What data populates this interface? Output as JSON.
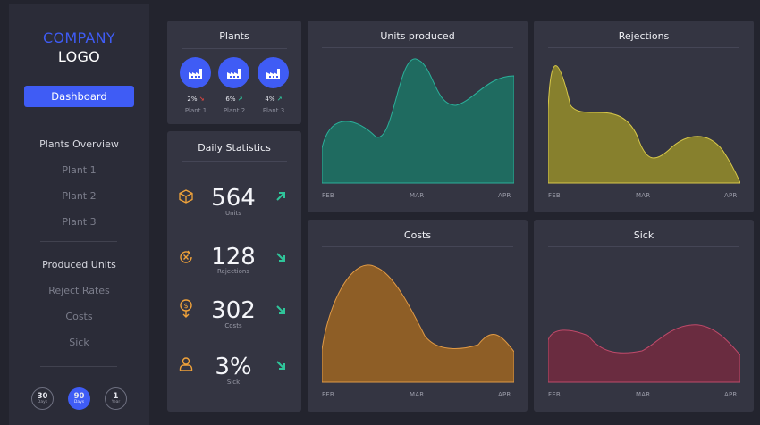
{
  "sidebar": {
    "logo_line1": "COMPANY",
    "logo_line2": "LOGO",
    "dashboard_label": "Dashboard",
    "sections": {
      "plants_overview": "Plants Overview",
      "plant1": "Plant 1",
      "plant2": "Plant 2",
      "plant3": "Plant 3",
      "produced_units": "Produced Units",
      "reject_rates": "Reject Rates",
      "costs": "Costs",
      "sick": "Sick"
    },
    "ranges": [
      {
        "num": "30",
        "unit": "Days",
        "active": false
      },
      {
        "num": "90",
        "unit": "Days",
        "active": true
      },
      {
        "num": "1",
        "unit": "Year",
        "active": false
      }
    ]
  },
  "plants_card": {
    "title": "Plants",
    "plants": [
      {
        "pct": "2%",
        "trend": "↘",
        "label": "Plant 1"
      },
      {
        "pct": "6%",
        "trend": "↗",
        "label": "Plant 2"
      },
      {
        "pct": "4%",
        "trend": "↗",
        "label": "Plant 3"
      }
    ]
  },
  "daily_stats": {
    "title": "Daily Statistics",
    "stats": [
      {
        "value": "564",
        "label": "Units",
        "icon": "box-icon",
        "trend": "up"
      },
      {
        "value": "128",
        "label": "Rejections",
        "icon": "reject-clock-icon",
        "trend": "down"
      },
      {
        "value": "302",
        "label": "Costs",
        "icon": "money-down-icon",
        "trend": "down"
      },
      {
        "value": "3%",
        "label": "Sick",
        "icon": "person-icon",
        "trend": "down"
      }
    ]
  },
  "colors": {
    "accent": "#3f5cf5",
    "up": "#2fc59a",
    "down": "#e0463f",
    "units_fill": "#1f6b60",
    "rejections_fill": "#87802d",
    "costs_fill": "#8e5e26",
    "sick_fill": "#6a2c40"
  },
  "charts": {
    "units": {
      "title": "Units produced",
      "x_labels": [
        "FEB",
        "MAR",
        "APR"
      ]
    },
    "rejections": {
      "title": "Rejections",
      "x_labels": [
        "FEB",
        "MAR",
        "APR"
      ]
    },
    "costs": {
      "title": "Costs",
      "x_labels": [
        "FEB",
        "MAR",
        "APR"
      ]
    },
    "sick": {
      "title": "Sick",
      "x_labels": [
        "FEB",
        "MAR",
        "APR"
      ]
    }
  }
}
